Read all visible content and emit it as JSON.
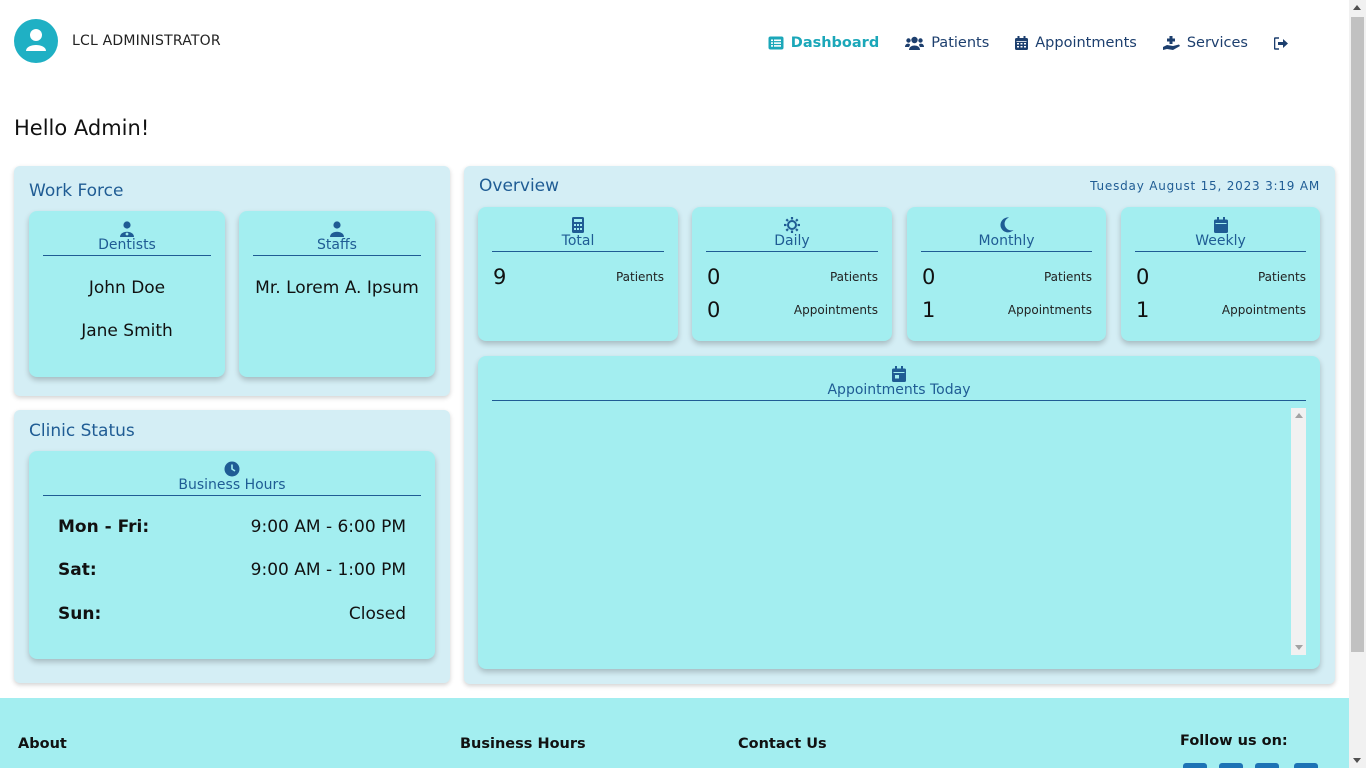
{
  "header": {
    "brand": "LCL ADMINISTRATOR",
    "nav": [
      {
        "label": "Dashboard",
        "icon": "list-icon",
        "active": true
      },
      {
        "label": "Patients",
        "icon": "users-icon",
        "active": false
      },
      {
        "label": "Appointments",
        "icon": "calendar-icon",
        "active": false
      },
      {
        "label": "Services",
        "icon": "hand-holding-medical-icon",
        "active": false
      },
      {
        "label": "",
        "icon": "logout-icon",
        "active": false
      }
    ]
  },
  "greeting": "Hello Admin!",
  "workforce": {
    "title": "Work Force",
    "dentists": {
      "title": "Dentists",
      "names": [
        "John Doe",
        "Jane Smith"
      ]
    },
    "staffs": {
      "title": "Staffs",
      "names": [
        "Mr. Lorem A. Ipsum"
      ]
    }
  },
  "clinic_status": {
    "title": "Clinic Status",
    "card_title": "Business Hours",
    "hours": [
      {
        "day": "Mon - Fri:",
        "time": "9:00 AM - 6:00 PM"
      },
      {
        "day": "Sat:",
        "time": "9:00 AM - 1:00 PM"
      },
      {
        "day": "Sun:",
        "time": "Closed"
      }
    ]
  },
  "overview": {
    "title": "Overview",
    "date": "Tuesday August 15, 2023 3:19 AM",
    "cards": [
      {
        "title": "Total",
        "icon": "calculator-icon",
        "patients": "9",
        "patients_label": "Patients"
      },
      {
        "title": "Daily",
        "icon": "sun-icon",
        "patients": "0",
        "patients_label": "Patients",
        "appointments": "0",
        "appointments_label": "Appointments"
      },
      {
        "title": "Monthly",
        "icon": "moon-icon",
        "patients": "0",
        "patients_label": "Patients",
        "appointments": "1",
        "appointments_label": "Appointments"
      },
      {
        "title": "Weekly",
        "icon": "calendar-icon",
        "patients": "0",
        "patients_label": "Patients",
        "appointments": "1",
        "appointments_label": "Appointments"
      }
    ],
    "today": {
      "title": "Appointments Today",
      "icon": "calendar-day-icon"
    }
  },
  "footer": {
    "about": "About",
    "business_hours": "Business Hours",
    "contact": "Contact Us",
    "follow": "Follow us on:"
  },
  "colors": {
    "accent": "#1ba7b9",
    "primary_text": "#1f5c94",
    "card_bg": "#a3eef0",
    "panel_bg": "#d4eef5"
  }
}
